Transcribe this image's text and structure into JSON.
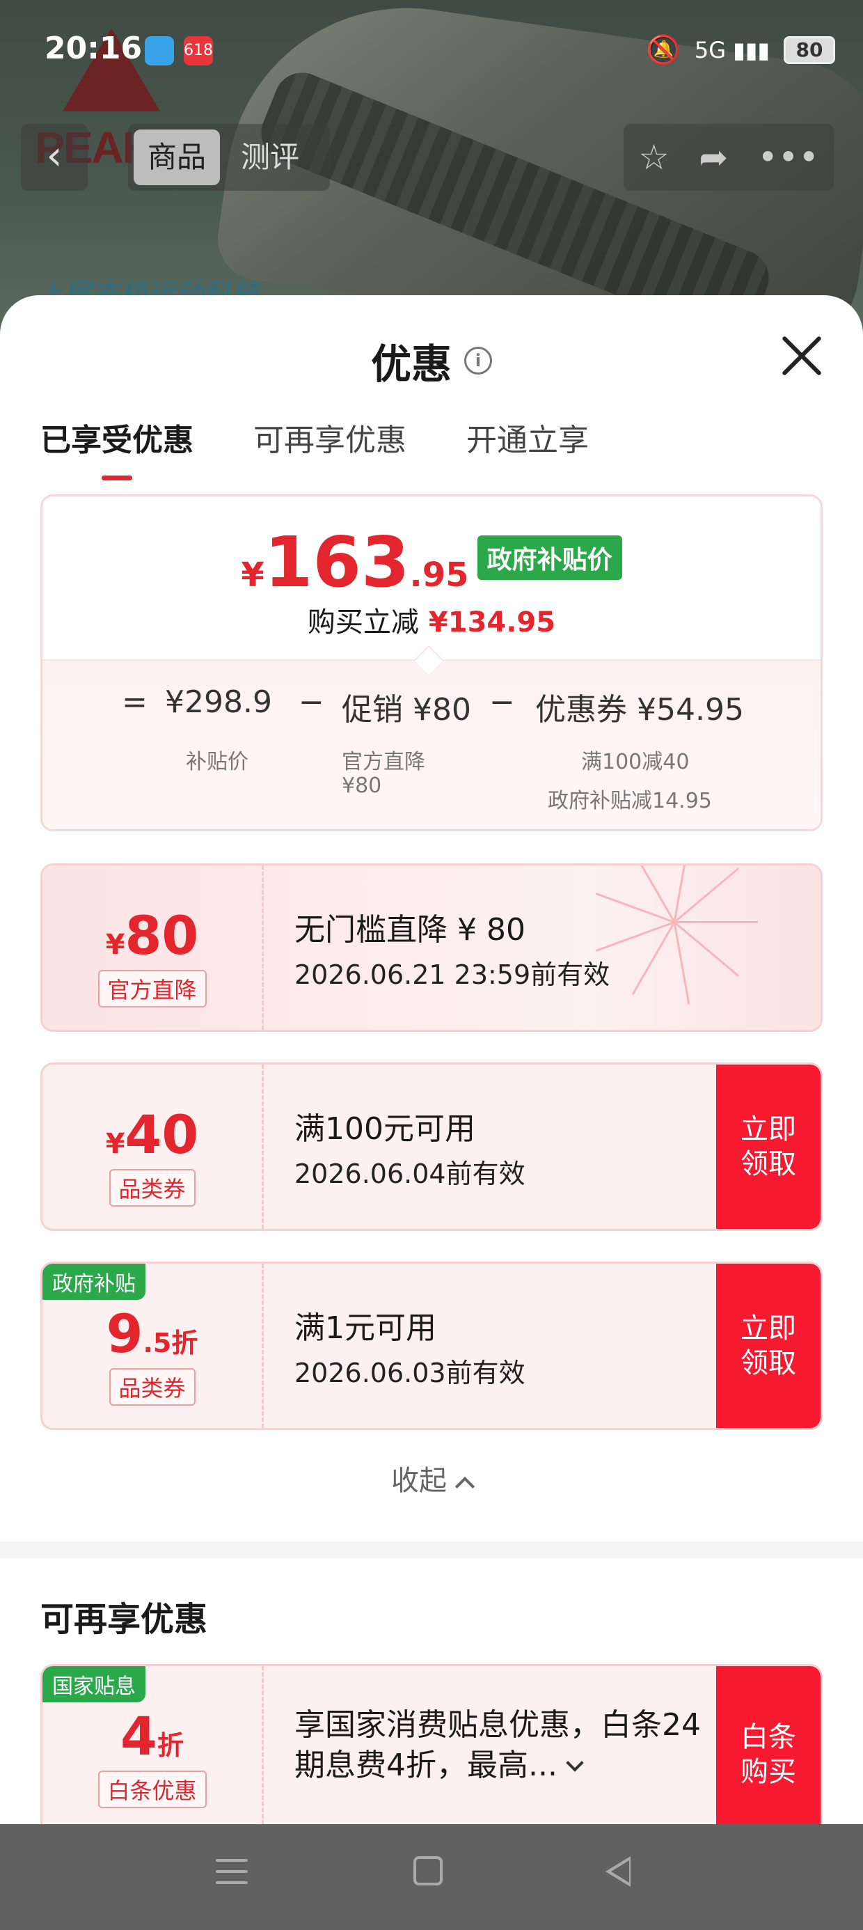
{
  "status_bar": {
    "time": "20:16",
    "app_badge_text": "618",
    "network": "5G",
    "battery": "80"
  },
  "background_page": {
    "brand_logo": "PEAK",
    "slogan": "上层态极运动科技",
    "nav": {
      "tabs": [
        "商品",
        "测评"
      ],
      "active_tab": 0,
      "back_icon": "chevron-left-icon",
      "actions": [
        "star-icon",
        "share-icon",
        "more-icon"
      ]
    }
  },
  "sheet": {
    "title": "优惠",
    "info_icon": "i",
    "tabs": [
      "已享受优惠",
      "可再享优惠",
      "开通立享"
    ],
    "active_tab": 0,
    "summary": {
      "currency": "¥",
      "price_int": "163",
      "price_dec": ".95",
      "badge": "政府补贴价",
      "cut_label": "购买立减",
      "cut_amount": "¥134.95",
      "eq": "=",
      "minus": "−",
      "base_value": "¥298.9",
      "base_label": "补贴价",
      "promo_value": "促销 ¥80",
      "promo_label_1": "官方直降",
      "promo_label_2": "¥80",
      "coupon_value": "优惠券 ¥54.95",
      "coupon_label_1": "满100减40",
      "coupon_label_2": "政府补贴减14.95"
    },
    "coupons": [
      {
        "currency": "¥",
        "value": "80",
        "tag": "官方直降",
        "title": "无门槛直降 ¥ 80",
        "validity": "2026.06.21 23:59前有效"
      },
      {
        "currency": "¥",
        "value": "40",
        "tag": "品类券",
        "title": "满100元可用",
        "validity": "2026.06.04前有效",
        "button": "立即\n领取"
      },
      {
        "corner": "政府补贴",
        "value": "9",
        "value_dec": ".5折",
        "tag": "品类券",
        "title": "满1元可用",
        "validity": "2026.06.03前有效",
        "button": "立即\n领取"
      }
    ],
    "collapse_label": "收起",
    "section2_title": "可再享优惠",
    "coupon_more": {
      "corner": "国家贴息",
      "value": "4",
      "value_dec": "折",
      "tag": "白条优惠",
      "title": "享国家消费贴息优惠，白条24期息费4折，最高...",
      "button": "白条\n购买"
    }
  },
  "colors": {
    "accent_red": "#e3262e",
    "button_red": "#f7192f",
    "gov_green": "#2aa84a"
  }
}
